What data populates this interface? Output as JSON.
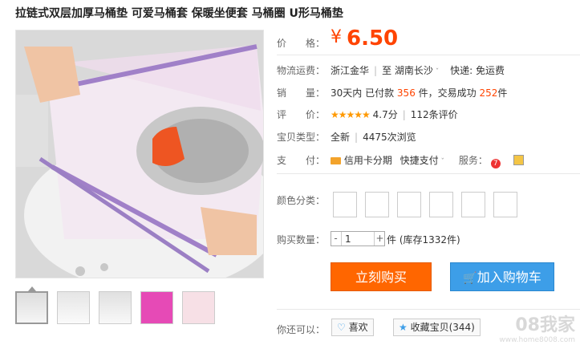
{
  "product": {
    "title": "拉链式双层加厚马桶垫 可爱马桶套 保暖坐便套 马桶圈 U形马桶垫"
  },
  "price": {
    "label": "价　　格：",
    "symbol": "¥",
    "value": "6.50"
  },
  "shipping": {
    "label": "物流运费：",
    "from": "浙江金华",
    "sep": "至",
    "to": "湖南长沙",
    "fee": "快递: 免运费"
  },
  "sales": {
    "label": "销　　量：",
    "prefix": "30天内 已付款",
    "paid": "356",
    "mid": "件，交易成功",
    "success": "252",
    "suffix": "件"
  },
  "rating": {
    "label": "评　　价：",
    "stars": "★★★★★",
    "score": "4.7分",
    "reviews": "112条评价"
  },
  "type": {
    "label": "宝贝类型：",
    "condition": "全新",
    "views": "4475次浏览"
  },
  "payment": {
    "label": "支　　付：",
    "installment": "信用卡分期",
    "quick_pay": "快捷支付",
    "service_label": "服务："
  },
  "color": {
    "label": "颜色分类：",
    "swatch_count": 6
  },
  "quantity": {
    "label": "购买数量：",
    "value": "1",
    "minus": "-",
    "plus": "+",
    "stock": "件 (库存1332件)"
  },
  "buttons": {
    "buy_now": "立刻购买",
    "add_cart": "加入购物车"
  },
  "social": {
    "label": "你还可以：",
    "like": "喜欢",
    "favorite": "收藏宝贝(344)"
  },
  "watermark": {
    "text": "08我家",
    "url": "www.home8008.com"
  },
  "colors": {
    "accent": "#ff4400",
    "buy": "#ff6600",
    "cart": "#3d9ee8"
  }
}
